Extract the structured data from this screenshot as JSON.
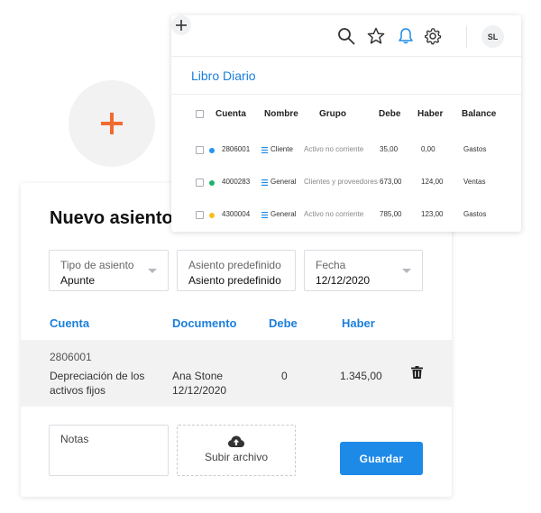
{
  "entry": {
    "title": "Nuevo asiento",
    "fields": [
      {
        "label": "Tipo de asiento",
        "value": "Apunte"
      },
      {
        "label": "Asiento predefinido",
        "value": "Asiento predefinido"
      },
      {
        "label": "Fecha",
        "value": "12/12/2020"
      }
    ],
    "columns": [
      "Cuenta",
      "Documento",
      "Debe",
      "Haber"
    ],
    "row": {
      "account": "2806001",
      "description_line1": "Depreciación de los",
      "description_line2": "activos fijos",
      "document_name": "Ana Stone",
      "document_date": "12/12/2020",
      "debe": "0",
      "haber": "1.345,00"
    },
    "notes_label": "Notas",
    "upload_label": "Subir archivo",
    "save_label": "Guardar"
  },
  "diario": {
    "avatar_initials": "SL",
    "title": "Libro Diario",
    "headers": [
      "Cuenta",
      "Nombre",
      "Grupo",
      "Debe",
      "Haber",
      "Balance"
    ],
    "rows": [
      {
        "dot_color": "#2196f3",
        "cuenta": "2806001",
        "nombre": "Cliente",
        "grupo": "Activo no corriente",
        "debe": "35,00",
        "haber": "0,00",
        "balance": "Gastos"
      },
      {
        "dot_color": "#1bb36b",
        "cuenta": "4000283",
        "nombre": "General",
        "grupo": "Clientes y proveedores",
        "debe": "673,00",
        "haber": "124,00",
        "balance": "Ventas"
      },
      {
        "dot_color": "#f6be1f",
        "cuenta": "4300004",
        "nombre": "General",
        "grupo": "Activo no corriente",
        "debe": "785,00",
        "haber": "123,00",
        "balance": "Gastos"
      }
    ]
  },
  "colors": {
    "accent": "#1b7fdb",
    "button": "#1e8ae8",
    "plus": "#f26a2f"
  },
  "icons": [
    "plus-icon",
    "search-icon",
    "star-icon",
    "bell-icon",
    "gear-icon",
    "trash-icon",
    "cloud-upload-icon",
    "list-icon"
  ]
}
